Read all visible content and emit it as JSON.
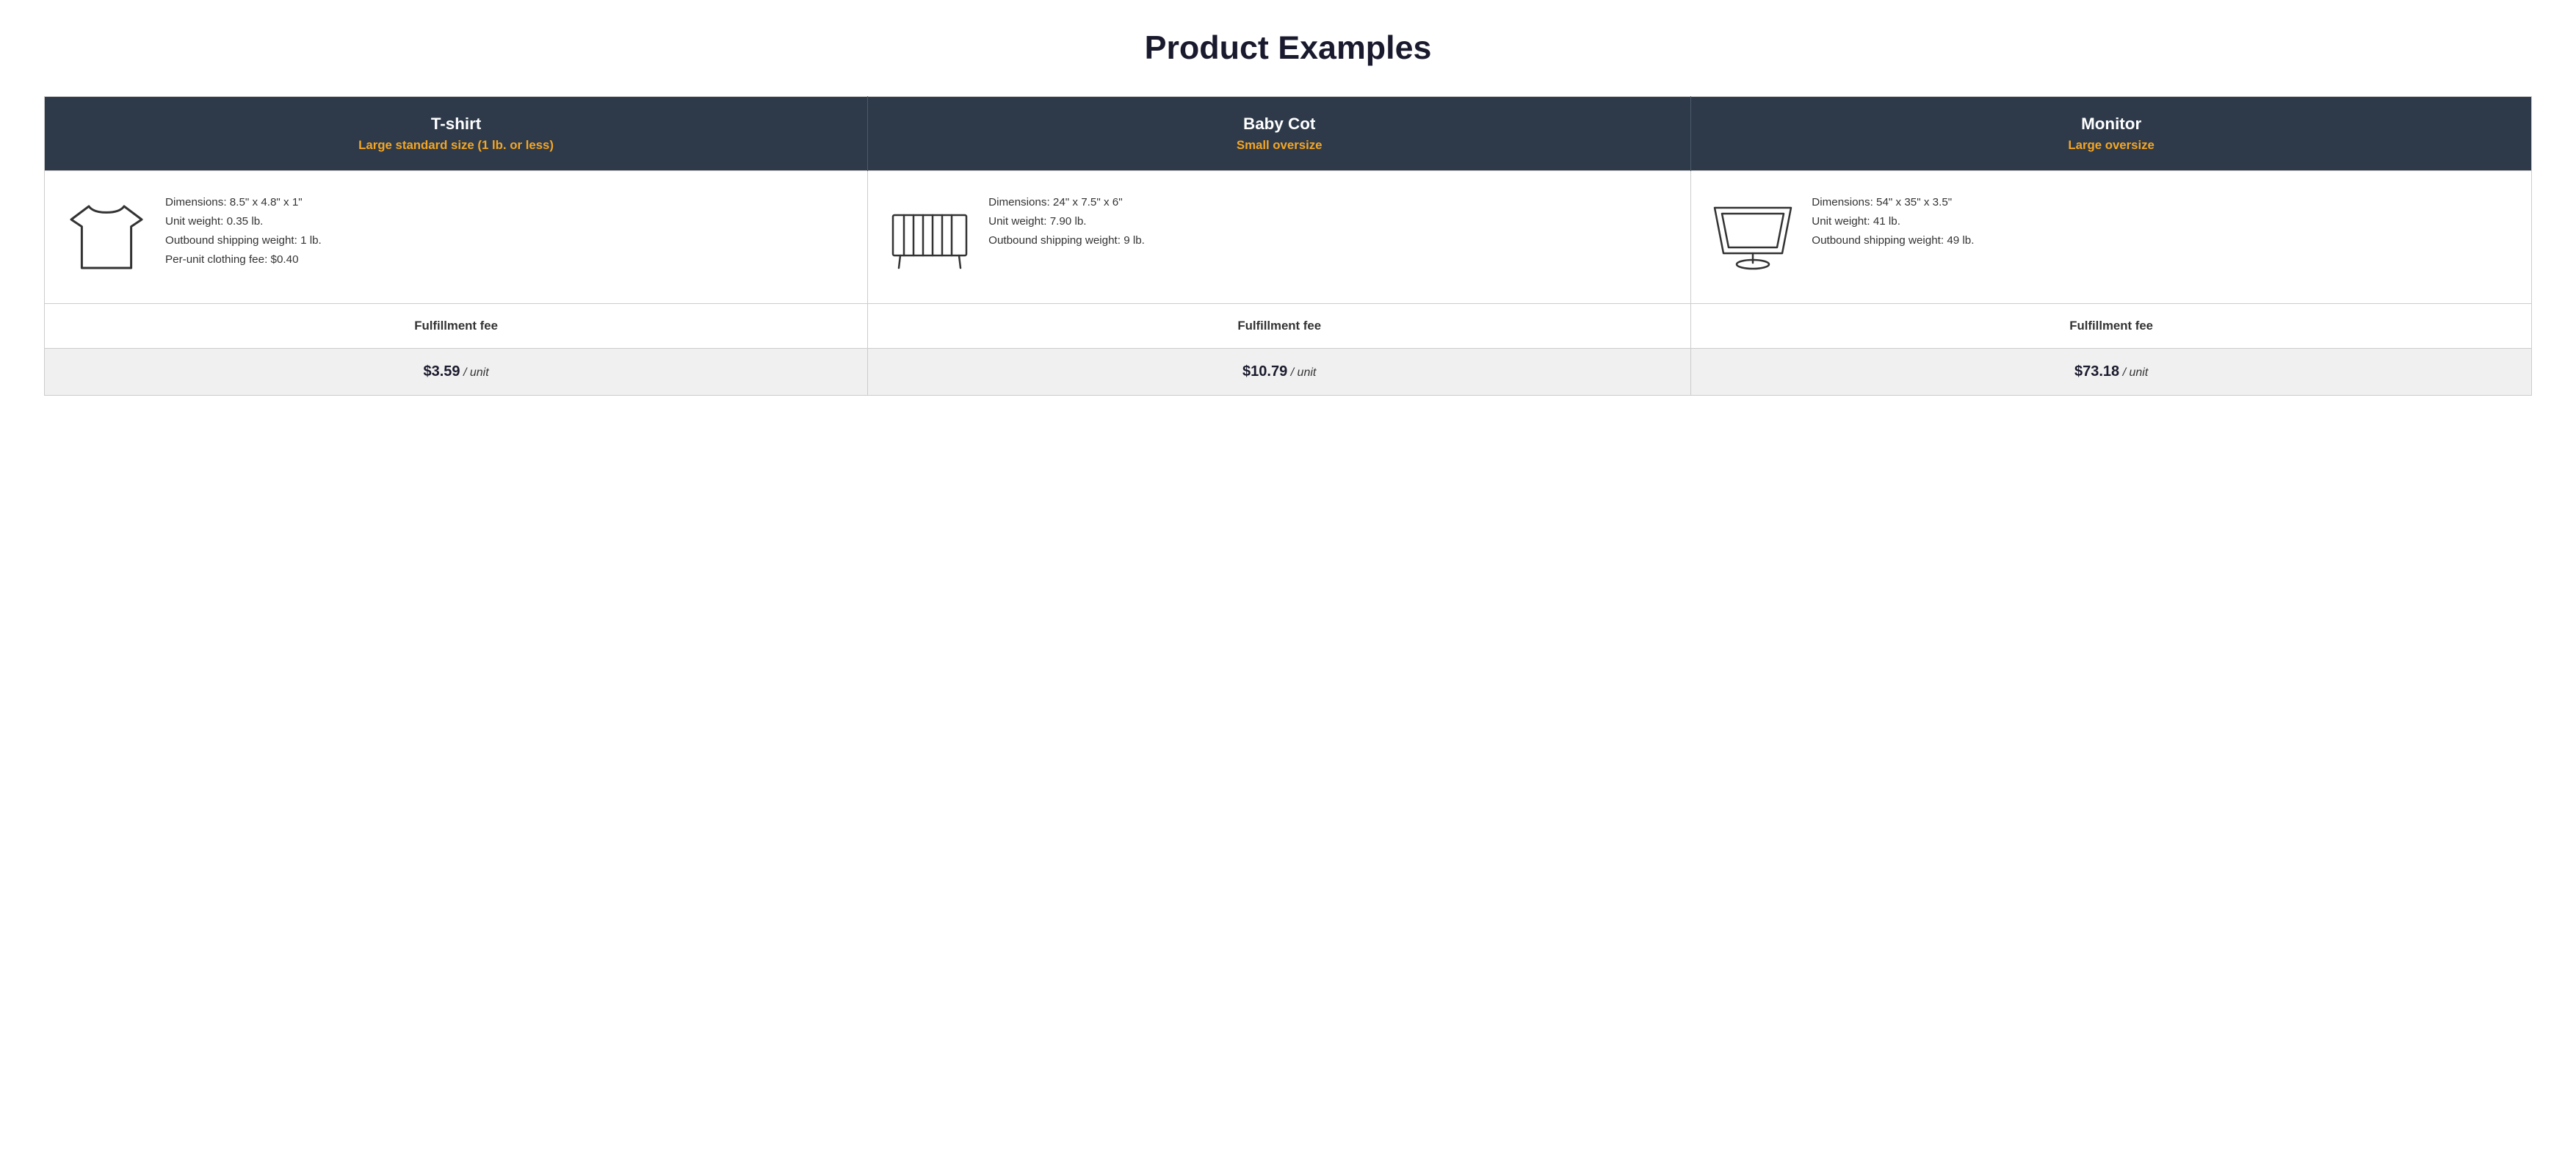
{
  "page": {
    "title": "Product Examples"
  },
  "table": {
    "columns": [
      {
        "id": "tshirt",
        "name": "T-shirt",
        "size_label": "Large standard size (1 lb. or less)",
        "dimensions": "Dimensions: 8.5\" x 4.8\" x 1\"",
        "unit_weight": "Unit weight: 0.35 lb.",
        "outbound_shipping": "Outbound shipping weight: 1 lb.",
        "extra_fee": "Per-unit clothing fee: $0.40",
        "fulfillment_fee_label": "Fulfillment fee",
        "fee_amount": "$3.59",
        "fee_unit": "/ unit"
      },
      {
        "id": "babycot",
        "name": "Baby Cot",
        "size_label": "Small oversize",
        "dimensions": "Dimensions: 24\" x 7.5\" x 6\"",
        "unit_weight": "Unit weight: 7.90 lb.",
        "outbound_shipping": "Outbound shipping weight: 9 lb.",
        "extra_fee": "",
        "fulfillment_fee_label": "Fulfillment fee",
        "fee_amount": "$10.79",
        "fee_unit": "/ unit"
      },
      {
        "id": "monitor",
        "name": "Monitor",
        "size_label": "Large oversize",
        "dimensions": "Dimensions: 54\" x 35\" x 3.5\"",
        "unit_weight": "Unit weight: 41 lb.",
        "outbound_shipping": "Outbound shipping weight: 49 lb.",
        "extra_fee": "",
        "fulfillment_fee_label": "Fulfillment fee",
        "fee_amount": "$73.18",
        "fee_unit": "/ unit"
      }
    ]
  }
}
